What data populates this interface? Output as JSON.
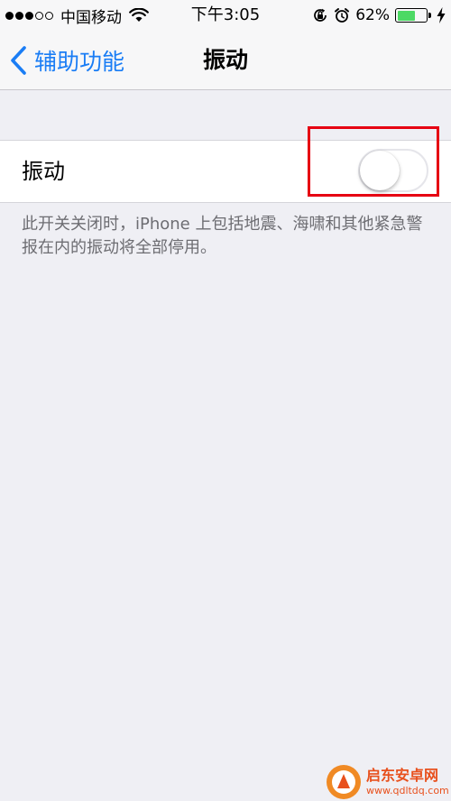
{
  "status_bar": {
    "signal_filled": 3,
    "signal_total": 5,
    "carrier": "中国移动",
    "time": "下午3:05",
    "battery_percent_label": "62%",
    "battery_level": 0.62,
    "battery_color": "#4cd964"
  },
  "nav": {
    "back_label": "辅助功能",
    "title": "振动",
    "accent_color": "#1a7df5"
  },
  "settings": {
    "vibration_row": {
      "label": "振动",
      "toggle_on": false
    },
    "footer_text": "此开关关闭时，iPhone 上包括地震、海啸和其他紧急警报在内的振动将全部停用。"
  },
  "annotation": {
    "highlight_color": "#e60012"
  },
  "watermark": {
    "title": "启东安卓网",
    "url": "www.qdltdq.com"
  }
}
